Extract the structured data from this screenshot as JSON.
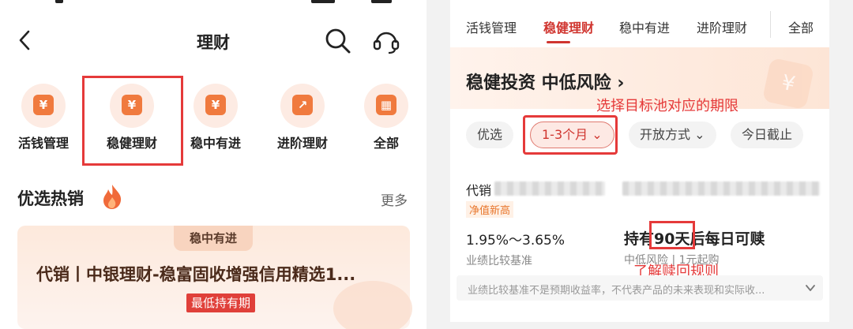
{
  "left": {
    "nav": {
      "title": "理财"
    },
    "categories": [
      {
        "label": "活钱管理",
        "glyph": "¥"
      },
      {
        "label": "稳健理财",
        "glyph": "¥"
      },
      {
        "label": "稳中有进",
        "glyph": "¥"
      },
      {
        "label": "进阶理财",
        "glyph": "↗"
      },
      {
        "label": "全部",
        "glyph": "▦"
      }
    ],
    "hot": {
      "title": "优选热销",
      "more": "更多"
    },
    "card": {
      "tag": "稳中有进",
      "name": "代销丨中银理财-稳富固收增强信用精选1...",
      "badge": "最低持有期"
    }
  },
  "right": {
    "tabs": [
      "活钱管理",
      "稳健理财",
      "稳中有进",
      "进阶理财",
      "全部"
    ],
    "active_tab": "稳健理财",
    "banner": {
      "title": "稳健投资 中低风险 ›",
      "coin": "¥"
    },
    "annotation_pool": "选择目标池对应的期限",
    "filters": [
      "优选",
      "1-3个月 ⌄",
      "开放方式 ⌄",
      "今日截止"
    ],
    "product": {
      "name_prefix": "代销",
      "tag": "净值新高",
      "rate": "1.95%～3.65%",
      "rate_label": "业绩比较基准",
      "hold": "持有90天后每日可赎",
      "risk": "中低风险 | 1元起购"
    },
    "annotation_redeem": "了解赎回规则",
    "disclaimer": "业绩比较基准不是预期收益率，不代表产品的未来表现和实际收..."
  },
  "colors": {
    "accent": "#d0352f",
    "highlight": "#e53a3a",
    "orange": "#f07a3e"
  }
}
